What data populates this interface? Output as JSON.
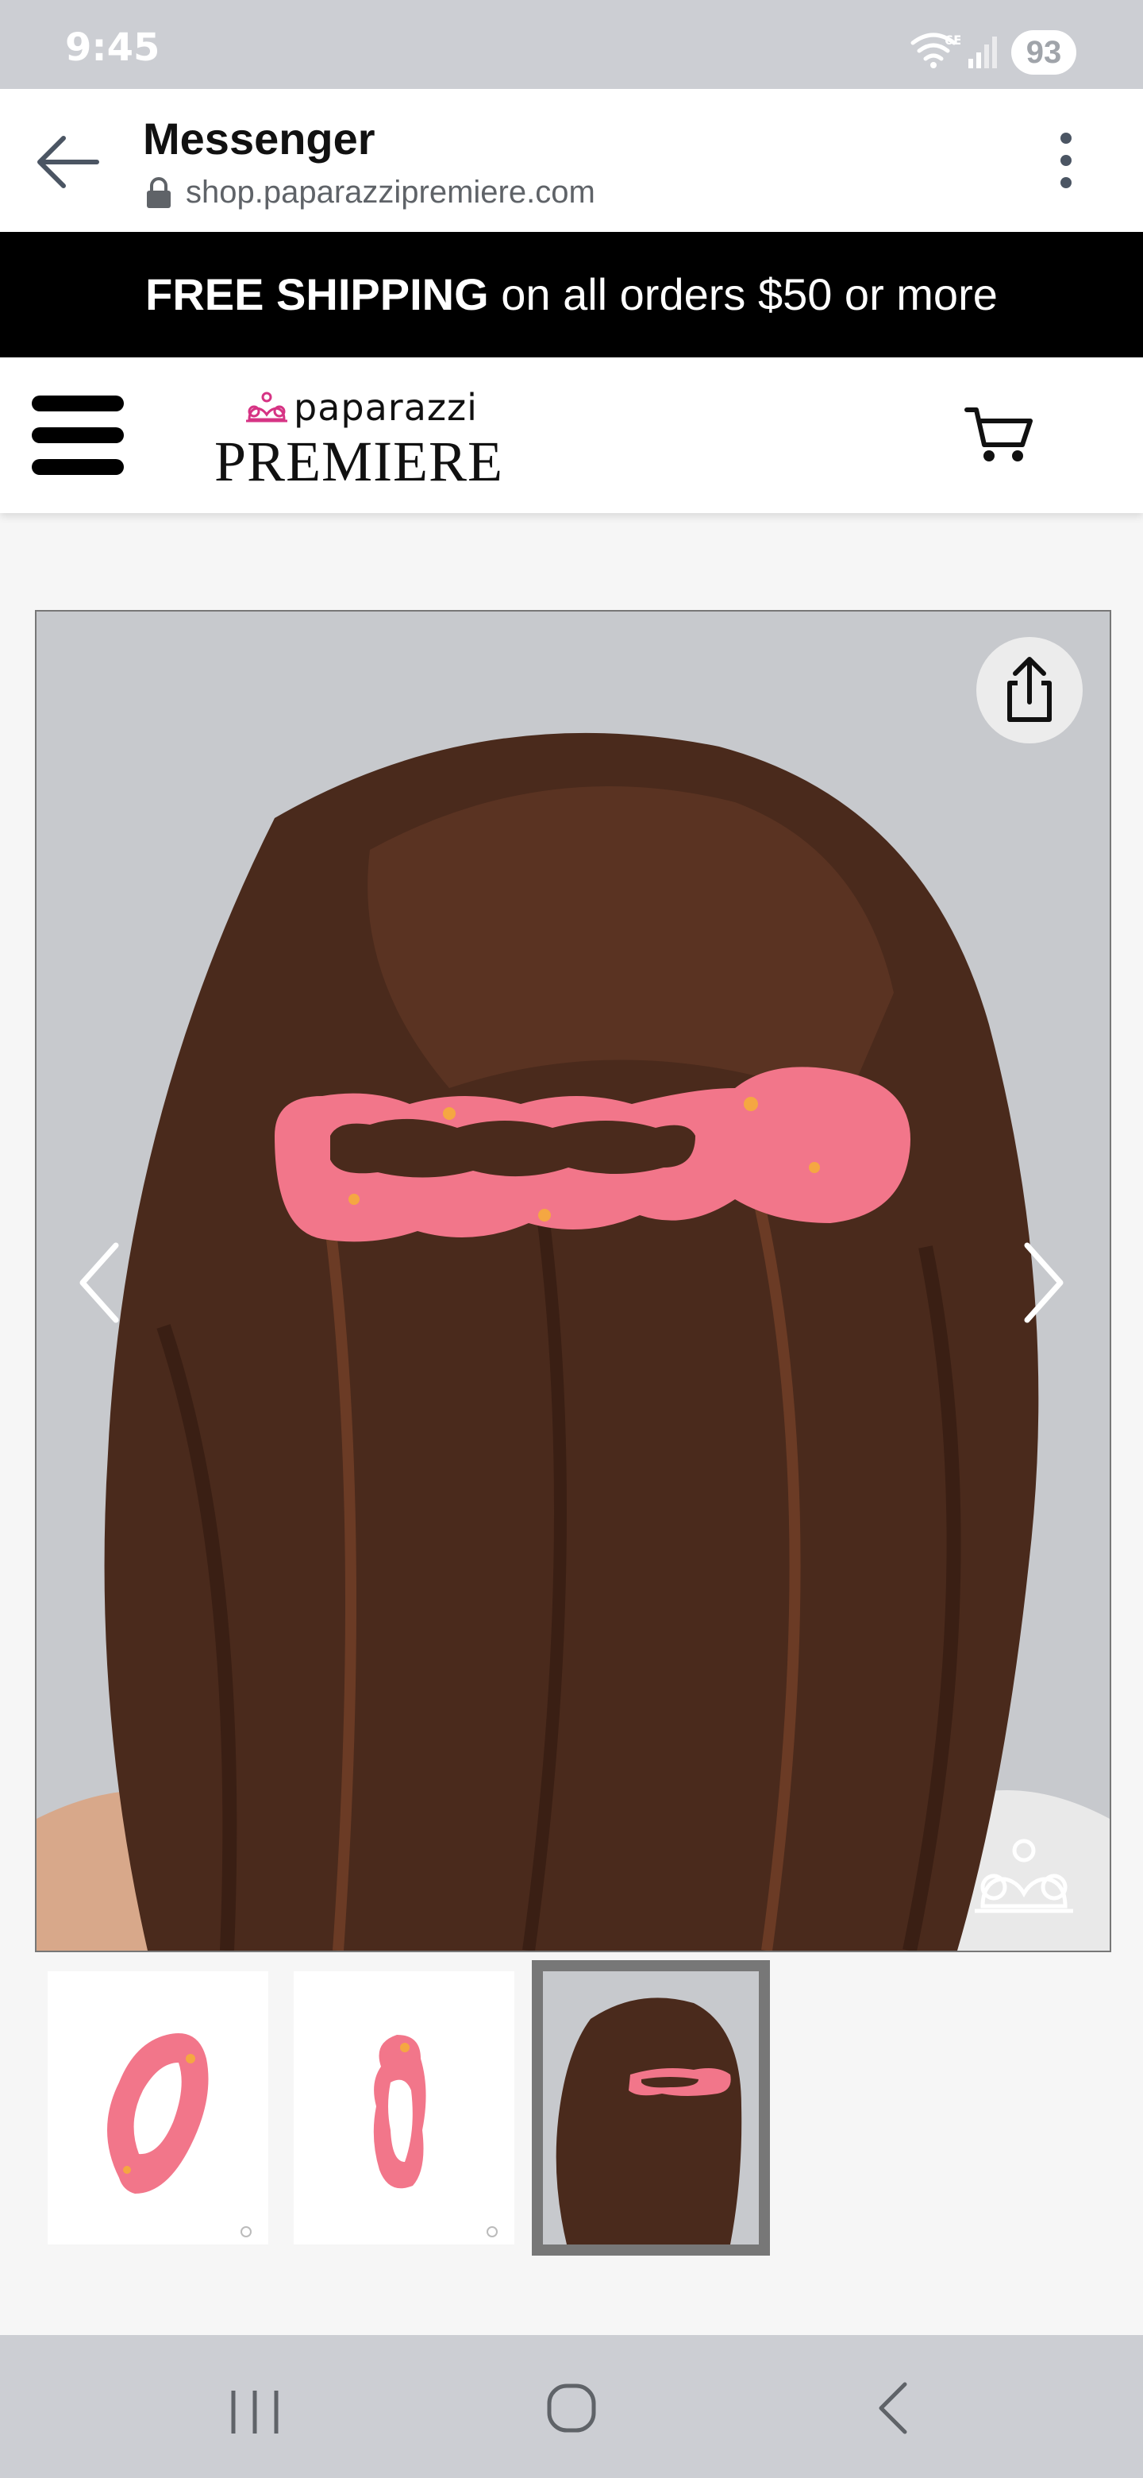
{
  "status_bar": {
    "time": "9:45",
    "network": "6E",
    "battery": "93"
  },
  "browser": {
    "title": "Messenger",
    "url": "shop.paparazzipremiere.com"
  },
  "promo": {
    "bold": "FREE SHIPPING",
    "text": " on all orders $50 or more"
  },
  "site": {
    "logo_script": "paparazzi",
    "logo_word": "PREMIERE"
  },
  "gallery": {
    "main_image": "model-hair-clip-back-view",
    "thumbnails": [
      {
        "name": "clip-angle-view",
        "selected": false
      },
      {
        "name": "clip-side-view",
        "selected": false
      },
      {
        "name": "model-back-view",
        "selected": true
      }
    ]
  },
  "colors": {
    "clip_pink": "#f2768a",
    "hair": "#4a2a1c",
    "background_gray": "#c7c9cd",
    "banner": "#000000"
  }
}
